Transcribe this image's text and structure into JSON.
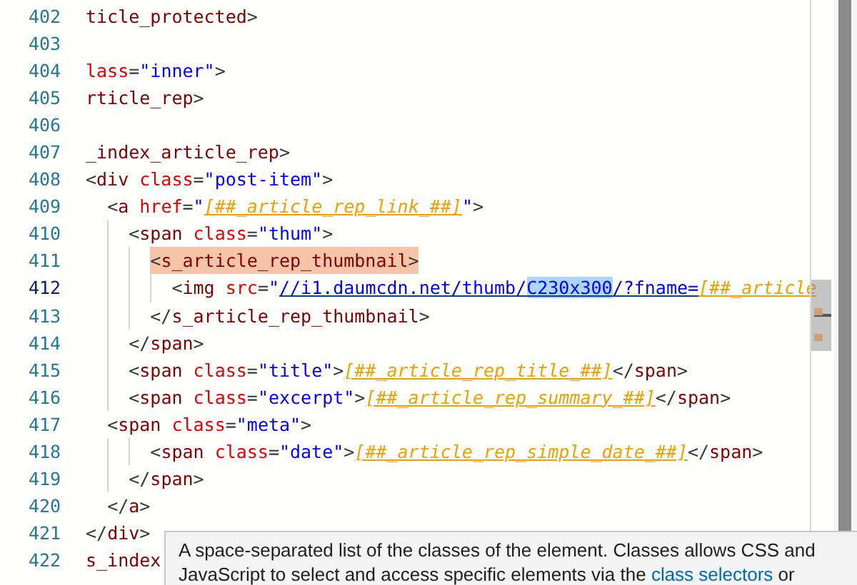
{
  "editor": {
    "lines": [
      {
        "number": "402",
        "current": false,
        "matched": false,
        "tokens": [
          {
            "kind": "tag",
            "text": "ticle_protected"
          },
          {
            "kind": "punct",
            "text": ">"
          }
        ]
      },
      {
        "number": "403",
        "current": false
      },
      {
        "number": "404",
        "current": false,
        "matched": false,
        "tokens": [
          {
            "kind": "attr",
            "text": "lass"
          },
          {
            "kind": "punct",
            "text": "="
          },
          {
            "kind": "string",
            "text": "\"inner\""
          },
          {
            "kind": "punct",
            "text": ">"
          }
        ]
      },
      {
        "number": "405",
        "current": false,
        "matched": false,
        "tokens": [
          {
            "kind": "tag",
            "text": "rticle_rep"
          },
          {
            "kind": "punct",
            "text": ">"
          }
        ]
      },
      {
        "number": "406",
        "current": false
      },
      {
        "number": "407",
        "current": false,
        "matched": false,
        "tokens": [
          {
            "kind": "tag",
            "text": "_index_article_rep"
          },
          {
            "kind": "punct",
            "text": ">"
          }
        ]
      },
      {
        "number": "408",
        "current": false,
        "matched": false,
        "tokens": [
          {
            "kind": "punct",
            "text": "<"
          },
          {
            "kind": "tag",
            "text": "div"
          },
          {
            "kind": "attr",
            "text": " class"
          },
          {
            "kind": "punct",
            "text": "="
          },
          {
            "kind": "string",
            "text": "\"post-item\""
          },
          {
            "kind": "punct",
            "text": ">"
          }
        ]
      },
      {
        "number": "409",
        "current": false,
        "matched": false,
        "tokens": [
          {
            "kind": "punct",
            "text": "  <"
          },
          {
            "kind": "tag",
            "text": "a"
          },
          {
            "kind": "attr",
            "text": " href"
          },
          {
            "kind": "punct",
            "text": "="
          },
          {
            "kind": "string",
            "text": "\""
          },
          {
            "kind": "placeholder",
            "text": "[##_article_rep_link_##]"
          },
          {
            "kind": "string",
            "text": "\""
          },
          {
            "kind": "punct",
            "text": ">"
          }
        ]
      },
      {
        "number": "410",
        "current": false,
        "matched": false,
        "tokens": [
          {
            "kind": "punct",
            "text": "    <"
          },
          {
            "kind": "tag",
            "text": "span"
          },
          {
            "kind": "attr",
            "text": " class"
          },
          {
            "kind": "punct",
            "text": "="
          },
          {
            "kind": "string",
            "text": "\"thum\""
          },
          {
            "kind": "punct",
            "text": ">"
          }
        ]
      },
      {
        "number": "411",
        "current": false,
        "matched": true,
        "tokens": [
          {
            "kind": "punct",
            "text": "      <"
          },
          {
            "kind": "tag",
            "text": "s_article_rep_thumbnail"
          },
          {
            "kind": "punct",
            "text": ">"
          }
        ]
      },
      {
        "number": "412",
        "current": true,
        "matched": false,
        "tokens": [
          {
            "kind": "punct",
            "text": "        <"
          },
          {
            "kind": "tag",
            "text": "img"
          },
          {
            "kind": "attr",
            "text": " src"
          },
          {
            "kind": "punct",
            "text": "="
          },
          {
            "kind": "string",
            "text": "\""
          },
          {
            "kind": "link",
            "text": "//i1.daumcdn.net/thumb/"
          },
          {
            "kind": "selection",
            "text": "C230x300"
          },
          {
            "kind": "link",
            "text": "/?fname="
          },
          {
            "kind": "placeholder",
            "text": "[##_article"
          }
        ]
      },
      {
        "number": "413",
        "current": false,
        "matched": false,
        "tokens": [
          {
            "kind": "punct",
            "text": "      </"
          },
          {
            "kind": "tag",
            "text": "s_article_rep_thumbnail"
          },
          {
            "kind": "punct",
            "text": ">"
          }
        ]
      },
      {
        "number": "414",
        "current": false,
        "matched": false,
        "tokens": [
          {
            "kind": "punct",
            "text": "    </"
          },
          {
            "kind": "tag",
            "text": "span"
          },
          {
            "kind": "punct",
            "text": ">"
          }
        ]
      },
      {
        "number": "415",
        "current": false,
        "matched": false,
        "tokens": [
          {
            "kind": "punct",
            "text": "    <"
          },
          {
            "kind": "tag",
            "text": "span"
          },
          {
            "kind": "attr",
            "text": " class"
          },
          {
            "kind": "punct",
            "text": "="
          },
          {
            "kind": "string",
            "text": "\"title\""
          },
          {
            "kind": "punct",
            "text": ">"
          },
          {
            "kind": "placeholder",
            "text": "[##_article_rep_title_##]"
          },
          {
            "kind": "punct",
            "text": "</"
          },
          {
            "kind": "tag",
            "text": "span"
          },
          {
            "kind": "punct",
            "text": ">"
          }
        ]
      },
      {
        "number": "416",
        "current": false,
        "matched": false,
        "tokens": [
          {
            "kind": "punct",
            "text": "    <"
          },
          {
            "kind": "tag",
            "text": "span"
          },
          {
            "kind": "attr",
            "text": " class"
          },
          {
            "kind": "punct",
            "text": "="
          },
          {
            "kind": "string",
            "text": "\"excerpt\""
          },
          {
            "kind": "punct",
            "text": ">"
          },
          {
            "kind": "placeholder",
            "text": "[##_article_rep_summary_##]"
          },
          {
            "kind": "punct",
            "text": "</"
          },
          {
            "kind": "tag",
            "text": "span"
          },
          {
            "kind": "punct",
            "text": ">"
          }
        ]
      },
      {
        "number": "417",
        "current": false,
        "matched": false,
        "tokens": [
          {
            "kind": "punct",
            "text": "  <"
          },
          {
            "kind": "tag",
            "text": "span"
          },
          {
            "kind": "attr",
            "text": " class"
          },
          {
            "kind": "punct",
            "text": "="
          },
          {
            "kind": "string",
            "text": "\"meta\""
          },
          {
            "kind": "punct",
            "text": ">"
          }
        ]
      },
      {
        "number": "418",
        "current": false,
        "matched": false,
        "tokens": [
          {
            "kind": "punct",
            "text": "      <"
          },
          {
            "kind": "tag",
            "text": "span"
          },
          {
            "kind": "attr",
            "text": " class"
          },
          {
            "kind": "punct",
            "text": "="
          },
          {
            "kind": "string",
            "text": "\"date\""
          },
          {
            "kind": "punct",
            "text": ">"
          },
          {
            "kind": "placeholder",
            "text": "[##_article_rep_simple_date_##]"
          },
          {
            "kind": "punct",
            "text": "</"
          },
          {
            "kind": "tag",
            "text": "span"
          },
          {
            "kind": "punct",
            "text": ">"
          }
        ]
      },
      {
        "number": "419",
        "current": false,
        "matched": false,
        "tokens": [
          {
            "kind": "punct",
            "text": "    </"
          },
          {
            "kind": "tag",
            "text": "span"
          },
          {
            "kind": "punct",
            "text": ">"
          }
        ]
      },
      {
        "number": "420",
        "current": false,
        "matched": false,
        "tokens": [
          {
            "kind": "punct",
            "text": "  </"
          },
          {
            "kind": "tag",
            "text": "a"
          },
          {
            "kind": "punct",
            "text": ">"
          }
        ]
      },
      {
        "number": "421",
        "current": false,
        "matched": false,
        "tokens": [
          {
            "kind": "punct",
            "text": "</"
          },
          {
            "kind": "tag",
            "text": "div"
          },
          {
            "kind": "punct",
            "text": ">"
          }
        ]
      },
      {
        "number": "422",
        "current": false,
        "matched": false,
        "tokens": [
          {
            "kind": "tag",
            "text": "s_index"
          }
        ]
      }
    ]
  },
  "tooltip": {
    "line_1": "A space-separated list of the classes of the element. Classes allows CSS and",
    "line_2_before": "JavaScript to select and access specific elements via the ",
    "link": "class selectors",
    "line_2_after": " or"
  }
}
